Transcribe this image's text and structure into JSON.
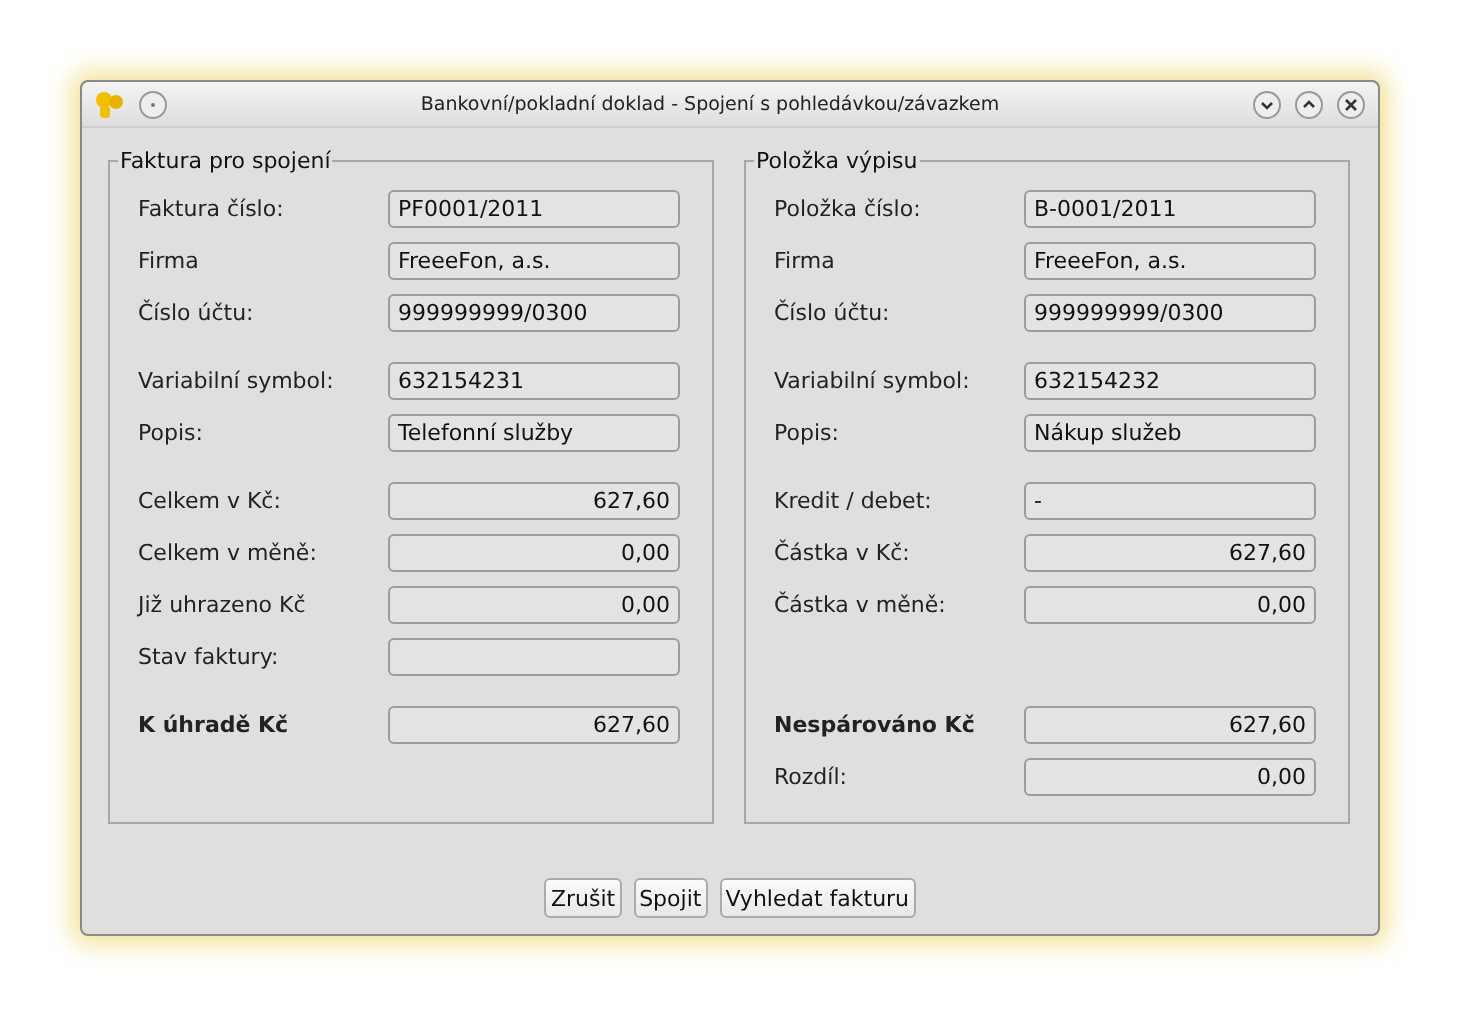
{
  "window": {
    "title": "Bankovní/pokladní doklad - Spojení s pohledávkou/závazkem"
  },
  "panels": [
    {
      "title": "Faktura pro spojení",
      "groups": [
        [
          {
            "label": "Faktura číslo:",
            "value": "PF0001/2011",
            "kind": "text",
            "bold": false
          },
          {
            "label": "Firma",
            "value": "FreeeFon, a.s.",
            "kind": "text",
            "bold": false
          },
          {
            "label": "Číslo účtu:",
            "value": "999999999/0300",
            "kind": "text",
            "bold": false
          }
        ],
        [
          {
            "label": "Variabilní symbol:",
            "value": "632154231",
            "kind": "text",
            "bold": false
          },
          {
            "label": "Popis:",
            "value": "Telefonní služby",
            "kind": "text",
            "bold": false
          }
        ],
        [
          {
            "label": "Celkem v Kč:",
            "value": "627,60",
            "kind": "amount",
            "bold": false
          },
          {
            "label": "Celkem v měně:",
            "value": "0,00",
            "kind": "amount",
            "bold": false
          },
          {
            "label": "Již uhrazeno Kč",
            "value": "0,00",
            "kind": "amount",
            "bold": false
          },
          {
            "label": "Stav faktury:",
            "kind": "text",
            "bold": false
          }
        ],
        [
          {
            "label": "K úhradě Kč",
            "value": "627,60",
            "kind": "amount",
            "bold": true
          }
        ]
      ]
    },
    {
      "title": "Položka výpisu",
      "groups": [
        [
          {
            "label": "Položka číslo:",
            "value": "B-0001/2011",
            "kind": "text",
            "bold": false
          },
          {
            "label": "Firma",
            "value": "FreeeFon, a.s.",
            "kind": "text",
            "bold": false
          },
          {
            "label": "Číslo účtu:",
            "value": "999999999/0300",
            "kind": "text",
            "bold": false
          }
        ],
        [
          {
            "label": "Variabilní symbol:",
            "value": "632154232",
            "kind": "text",
            "bold": false
          },
          {
            "label": "Popis:",
            "value": "Nákup služeb",
            "kind": "text",
            "bold": false
          }
        ],
        [
          {
            "label": "Kredit / debet:",
            "value": "-",
            "kind": "text",
            "bold": false
          },
          {
            "label": "Částka v Kč:",
            "value": "627,60",
            "kind": "amount",
            "bold": false
          },
          {
            "label": "Částka v měně:",
            "value": "0,00",
            "kind": "amount",
            "bold": false
          }
        ],
        [
          {
            "label": "Nespárováno Kč",
            "value": "627,60",
            "kind": "amount",
            "bold": true
          },
          {
            "label": "Rozdíl:",
            "value": "0,00",
            "kind": "amount",
            "bold": false
          }
        ]
      ]
    }
  ],
  "buttons": [
    "Zrušit",
    "Spojit",
    "Vyhledat fakturu"
  ]
}
